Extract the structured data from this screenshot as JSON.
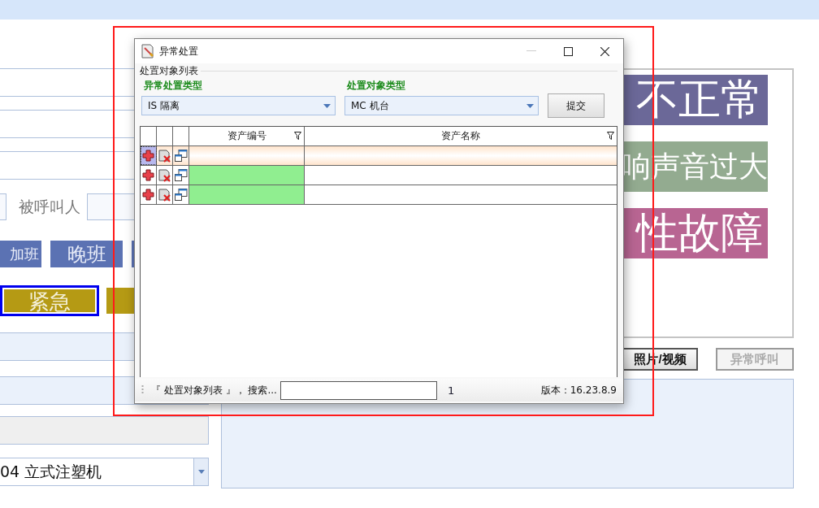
{
  "app": {
    "callee_label": "被呼叫人",
    "shift_buttons": [
      {
        "label": "加班"
      },
      {
        "label": "晚班"
      }
    ],
    "priority_buttons": [
      {
        "label": "紧急",
        "selected": true
      },
      {
        "selected": false
      }
    ],
    "machine_select": {
      "value": "04 立式注塑机"
    },
    "fault_bars": [
      {
        "text": "不正常",
        "color": "#6b6898",
        "kind": "large"
      },
      {
        "text": "响声音过大",
        "color": "#93ab90",
        "kind": "medium"
      },
      {
        "text": "性故障",
        "color": "#b86592",
        "kind": "large"
      }
    ],
    "buttons": [
      {
        "label": "照片/视频",
        "disabled": false
      },
      {
        "label": "异常呼叫",
        "disabled": true
      }
    ]
  },
  "dialog": {
    "title": "异常处置",
    "group_title": "处置对象列表",
    "fields": [
      {
        "label": "异常处置类型",
        "value": "IS 隔离"
      },
      {
        "label": "处置对象类型",
        "value": "MC 机台"
      }
    ],
    "submit": "提交",
    "grid": {
      "columns": [
        "资产编号",
        "资产名称"
      ],
      "rows": [
        {
          "selected": true,
          "highlighted": false
        },
        {
          "selected": false,
          "highlighted": true
        },
        {
          "selected": false,
          "highlighted": true
        }
      ]
    },
    "status": {
      "label": "『 处置对象列表 』， 搜索...",
      "count": "1",
      "version": "版本：16.23.8.9"
    }
  }
}
